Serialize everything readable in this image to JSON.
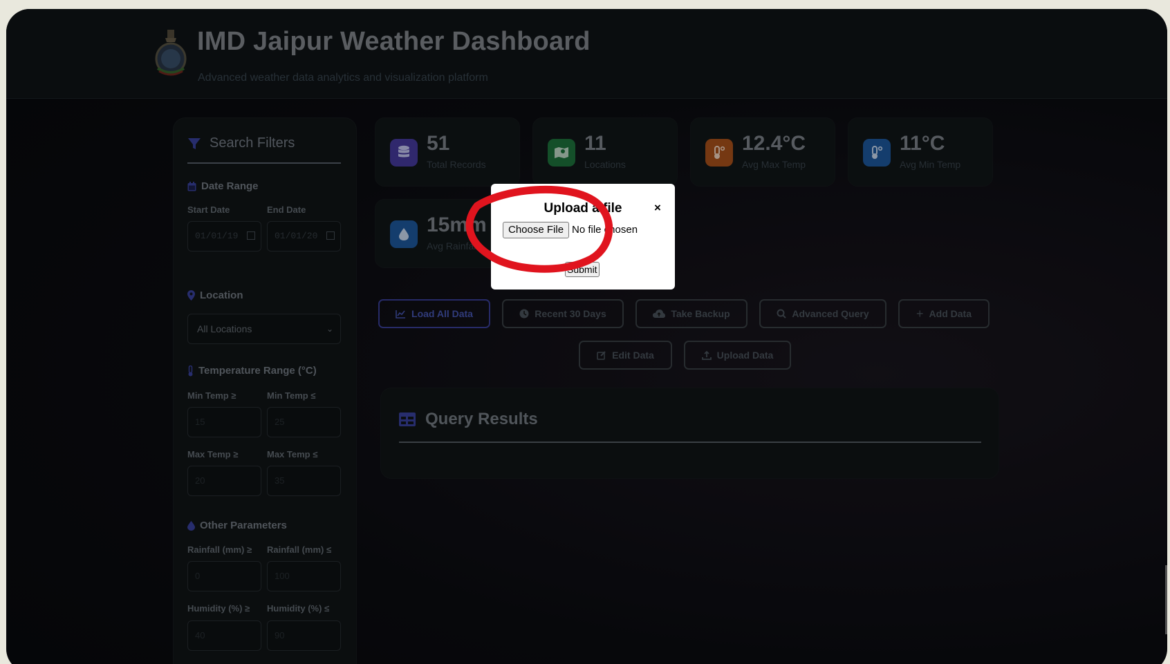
{
  "header": {
    "title": "IMD Jaipur Weather Dashboard",
    "subtitle": "Advanced weather data analytics and visualization platform",
    "logo_icon": "imd-emblem-icon"
  },
  "sidebar": {
    "title": "Search Filters",
    "date_range": {
      "heading": "Date Range",
      "start_label": "Start Date",
      "end_label": "End Date",
      "start_value": "01/01/19",
      "end_value": "01/01/20"
    },
    "location": {
      "heading": "Location",
      "selected": "All Locations"
    },
    "temperature": {
      "heading": "Temperature Range (°C)",
      "min_ge_label": "Min Temp ≥",
      "min_le_label": "Min Temp ≤",
      "min_ge_placeholder": "15",
      "min_le_placeholder": "25",
      "max_ge_label": "Max Temp ≥",
      "max_le_label": "Max Temp ≤",
      "max_ge_placeholder": "20",
      "max_le_placeholder": "35"
    },
    "other": {
      "heading": "Other Parameters",
      "rain_ge_label": "Rainfall (mm) ≥",
      "rain_le_label": "Rainfall (mm) ≤",
      "rain_ge_placeholder": "0",
      "rain_le_placeholder": "100",
      "hum_ge_label": "Humidity (%) ≥",
      "hum_le_label": "Humidity (%) ≤",
      "hum_ge_placeholder": "40",
      "hum_le_placeholder": "90"
    }
  },
  "stats": [
    {
      "value": "51",
      "caption": "Total Records",
      "icon": "database-icon",
      "color": "#4b3ea8"
    },
    {
      "value": "11",
      "caption": "Locations",
      "icon": "map-icon",
      "color": "#1f7a3f"
    },
    {
      "value": "12.4°C",
      "caption": "Avg Max Temp",
      "icon": "thermometer-hot-icon",
      "color": "#b4561c"
    },
    {
      "value": "11°C",
      "caption": "Avg Min Temp",
      "icon": "thermometer-cold-icon",
      "color": "#1f5ea8"
    },
    {
      "value": "15mm",
      "caption": "Avg Rainfall",
      "icon": "raindrop-icon",
      "color": "#1f5ea8"
    }
  ],
  "actions": {
    "load_all": "Load All Data",
    "recent_30": "Recent 30 Days",
    "backup": "Take Backup",
    "advanced": "Advanced Query",
    "add": "Add Data",
    "edit": "Edit Data",
    "upload": "Upload Data"
  },
  "results": {
    "title": "Query Results"
  },
  "modal": {
    "title": "Upload a file",
    "close": "×",
    "choose_file": "Choose File",
    "file_status": "No file chosen",
    "submit": "Submit"
  },
  "annotation_color": "#e0141e"
}
